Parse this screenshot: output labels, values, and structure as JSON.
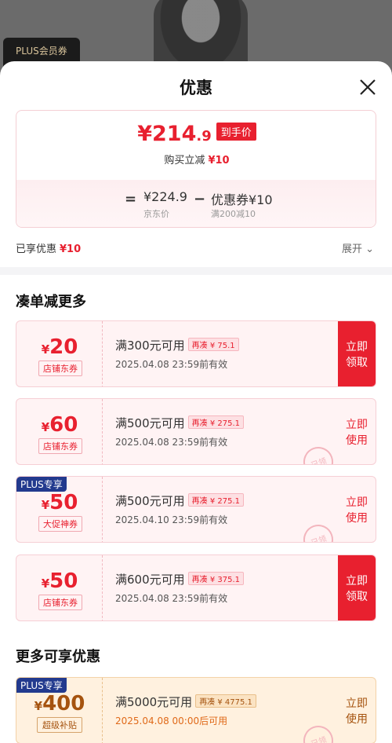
{
  "backdrop": {
    "plus_card_label": "PLUS会员券"
  },
  "sheet": {
    "title": "优惠"
  },
  "price_summary": {
    "final_price_int": "¥214",
    "final_price_dec": ".9",
    "price_tag": "到手价",
    "instant_label": "购买立减",
    "instant_value": "¥10",
    "eq_symbol": "=",
    "minus_symbol": "−",
    "jd_price": "¥224.9",
    "jd_price_label": "京东价",
    "coupon_label": "优惠券¥10",
    "coupon_condition": "满200减10"
  },
  "enjoyed": {
    "label": "已享优惠",
    "value": "¥10",
    "expand_label": "展开 ⌄"
  },
  "sections": {
    "more_discount": "凑单减更多",
    "more_offers": "更多可享优惠"
  },
  "coupons": [
    {
      "plus": "",
      "yen": "¥",
      "amount": "20",
      "type": "店铺东券",
      "condition": "满300元可用",
      "need": "再凑 ¥ 75.1",
      "valid": "2025.04.08  23:59前有效",
      "action": "立即\n领取",
      "state": "claim",
      "stamp": ""
    },
    {
      "plus": "",
      "yen": "¥",
      "amount": "60",
      "type": "店铺东券",
      "condition": "满500元可用",
      "need": "再凑 ¥ 275.1",
      "valid": "2025.04.08  23:59前有效",
      "action": "立即\n使用",
      "state": "use",
      "stamp": "已领"
    },
    {
      "plus": "PLUS专享",
      "yen": "¥",
      "amount": "50",
      "type": "大促神券",
      "condition": "满500元可用",
      "need": "再凑 ¥ 275.1",
      "valid": "2025.04.10  23:59前有效",
      "action": "立即\n使用",
      "state": "use",
      "stamp": "已领"
    },
    {
      "plus": "",
      "yen": "¥",
      "amount": "50",
      "type": "店铺东券",
      "condition": "满600元可用",
      "need": "再凑 ¥ 375.1",
      "valid": "2025.04.08  23:59前有效",
      "action": "立即\n领取",
      "state": "claim",
      "stamp": ""
    },
    {
      "plus": "PLUS专享",
      "yen": "¥",
      "amount": "400",
      "type": "超级补贴",
      "condition": "满5000元可用",
      "need": "再凑 ¥ 4775.1",
      "valid": "2025.04.08  00:00后可用",
      "action": "立即\n使用",
      "state": "use",
      "stamp": "已领"
    }
  ],
  "colors": {
    "accent_red": "#e8202f",
    "plus_blue": "#223a8e",
    "gold": "#a5530f"
  }
}
